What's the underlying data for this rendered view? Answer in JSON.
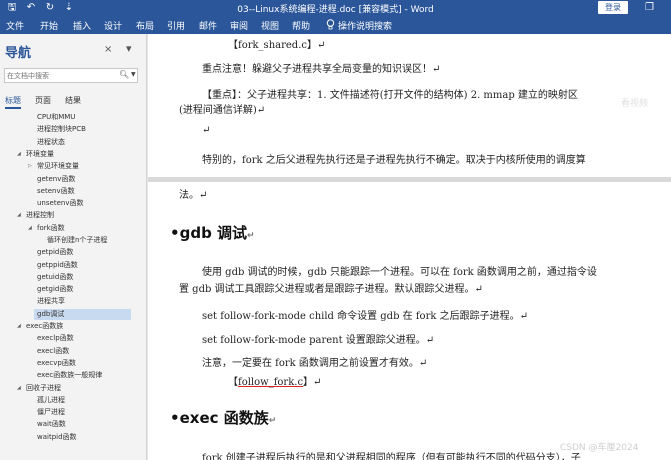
{
  "window": {
    "title": "03--Linux系统编程-进程.doc [兼容模式] - Word",
    "login_label": "登录",
    "qat": {
      "save": "🖫",
      "undo": "↶",
      "redo": "↻",
      "more": "⇣"
    },
    "restore_glyph": "❐"
  },
  "ribbon": {
    "tabs": [
      "文件",
      "开始",
      "插入",
      "设计",
      "布局",
      "引用",
      "邮件",
      "审阅",
      "视图",
      "帮助"
    ],
    "tell_me": "操作说明搜索",
    "tell_me_icon": "lightbulb-icon"
  },
  "nav": {
    "title": "导航",
    "close_glyph": "×",
    "pin_glyph": "▾",
    "search_placeholder": "在文档中搜索",
    "tabs": [
      "标题",
      "页面",
      "结果"
    ],
    "items": [
      {
        "label": "CPU和MMU",
        "expand": ""
      },
      {
        "label": "进程控制块PCB",
        "expand": ""
      },
      {
        "label": "进程状态",
        "expand": ""
      },
      {
        "label": "环境变量",
        "expand": "◢"
      },
      {
        "label": "常见环境变量",
        "expand": "▷"
      },
      {
        "label": "getenv函数",
        "expand": ""
      },
      {
        "label": "setenv函数",
        "expand": ""
      },
      {
        "label": "unsetenv函数",
        "expand": ""
      },
      {
        "label": "进程控制",
        "expand": "◢"
      },
      {
        "label": "fork函数",
        "expand": "◢"
      },
      {
        "label": "循环创建n个子进程",
        "expand": ""
      },
      {
        "label": "getpid函数",
        "expand": ""
      },
      {
        "label": "getppid函数",
        "expand": ""
      },
      {
        "label": "getuid函数",
        "expand": ""
      },
      {
        "label": "getgid函数",
        "expand": ""
      },
      {
        "label": "进程共享",
        "expand": ""
      },
      {
        "label": "gdb调试",
        "expand": ""
      },
      {
        "label": "exec函数族",
        "expand": "◢"
      },
      {
        "label": "execlp函数",
        "expand": ""
      },
      {
        "label": "execl函数",
        "expand": ""
      },
      {
        "label": "execvp函数",
        "expand": ""
      },
      {
        "label": "exec函数族一般规律",
        "expand": ""
      },
      {
        "label": "回收子进程",
        "expand": "◢"
      },
      {
        "label": "孤儿进程",
        "expand": ""
      },
      {
        "label": "僵尸进程",
        "expand": ""
      },
      {
        "label": "wait函数",
        "expand": ""
      },
      {
        "label": "waitpid函数",
        "expand": ""
      }
    ]
  },
  "doc": {
    "l1": "【fork_shared.c】↵",
    "l2": "重点注意！躲避父子进程共享全局变量的知识误区！↵",
    "l3a": "【重点】：父子进程共享：1. 文件描述符(打开文件的结构体)   2. mmap 建立的映射区",
    "l3b": "(进程间通信详解)↵",
    "l4": "↵",
    "l5": "特别的，fork 之后父进程先执行还是子进程先执行不确定。取决于内核所使用的调度算",
    "l6": "法。↵",
    "h_gdb": "gdb 调试",
    "h_mark": "↵",
    "g1a": "使用 gdb 调试的时候，gdb 只能跟踪一个进程。可以在 fork 函数调用之前，通过指令设",
    "g1b": "置 gdb 调试工具跟踪父进程或者是跟踪子进程。默认跟踪父进程。↵",
    "g2": "set follow-fork-mode child  命令设置 gdb 在 fork 之后跟踪子进程。↵",
    "g3": "set follow-fork-mode parent  设置跟踪父进程。↵",
    "g4": "注意，一定要在 fork 函数调用之前设置才有效。↵",
    "g5a": "【",
    "g5b": "follow_fork.c",
    "g5c": "】↵",
    "h_exec": "exec 函数族",
    "e1": "fork 创建子进程后执行的是和父进程相同的程序（但有可能执行不同的代码分支），子",
    "watermark_top": "看视频",
    "watermark_bottom": "CSDN @车厘2024"
  }
}
